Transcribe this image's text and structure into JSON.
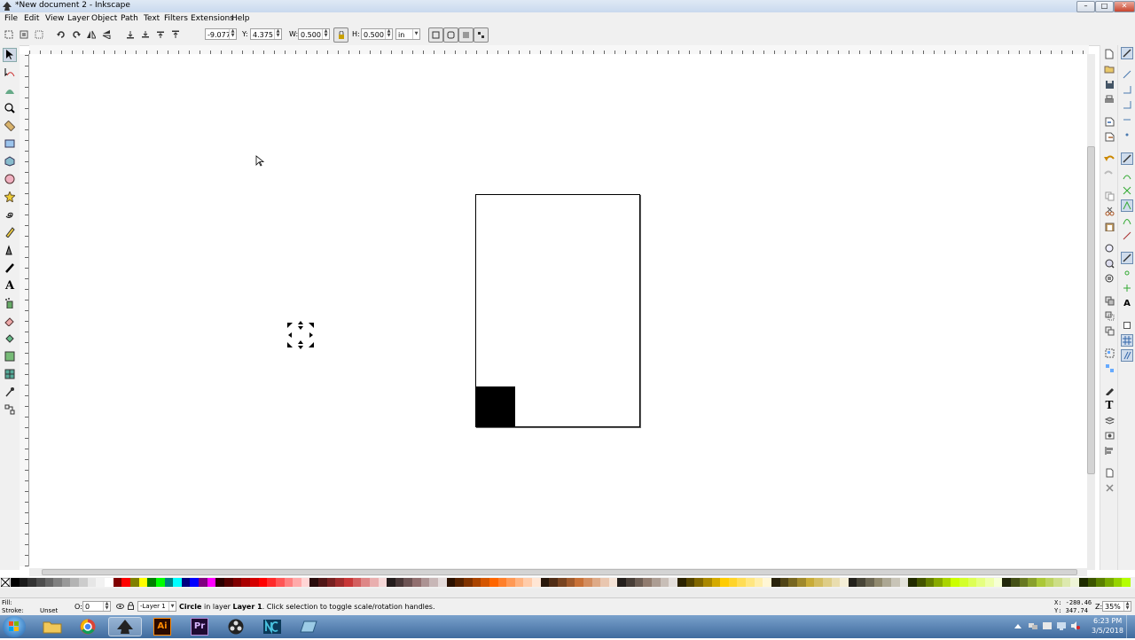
{
  "window": {
    "title": "*New document 2 - Inkscape"
  },
  "menu": [
    "File",
    "Edit",
    "View",
    "Layer",
    "Object",
    "Path",
    "Text",
    "Filters",
    "Extensions",
    "Help"
  ],
  "toolbar": {
    "x_label": "X:",
    "x_value": "-9.077",
    "y_label": "Y:",
    "y_value": "4.375",
    "w_label": "W:",
    "w_value": "0.500",
    "h_label": "H:",
    "h_value": "0.500",
    "unit": "in"
  },
  "status": {
    "fill_label": "Fill:",
    "stroke_label": "Stroke:",
    "stroke_value": "Unset",
    "opacity_label": "O:",
    "opacity_value": "0",
    "layer": "-Layer 1",
    "msg_bold": "Circle",
    "msg_mid": " in layer ",
    "msg_layer": "Layer 1",
    "msg_end": ". Click selection to toggle scale/rotation handles.",
    "cursor_x": "X: -280.46",
    "cursor_y": "Y:  347.74",
    "zoom_label": "Z:",
    "zoom_value": "35%"
  },
  "taskbar": {
    "time": "6:23 PM",
    "date": "3/5/2018"
  },
  "palette_colors": [
    "#000000",
    "#1a1a1a",
    "#333333",
    "#4d4d4d",
    "#666666",
    "#808080",
    "#999999",
    "#b3b3b3",
    "#cccccc",
    "#e6e6e6",
    "#f2f2f2",
    "#ffffff",
    "#800000",
    "#ff0000",
    "#808000",
    "#ffff00",
    "#008000",
    "#00ff00",
    "#008080",
    "#00ffff",
    "#000080",
    "#0000ff",
    "#800080",
    "#ff00ff",
    "#2b0000",
    "#550000",
    "#800000",
    "#aa0000",
    "#d40000",
    "#ff0000",
    "#ff2a2a",
    "#ff5555",
    "#ff8080",
    "#ffaaaa",
    "#ffd5d5",
    "#280b0b",
    "#501616",
    "#782121",
    "#a02c2c",
    "#c83737",
    "#d35f5f",
    "#de8787",
    "#e9afaf",
    "#f4d7d7",
    "#241c1c",
    "#483737",
    "#6c5353",
    "#916f6f",
    "#ac9393",
    "#c8b7b7",
    "#e3dbdb",
    "#2b1100",
    "#552200",
    "#803300",
    "#aa4400",
    "#d45500",
    "#ff6600",
    "#ff7f2a",
    "#ff9955",
    "#ffb380",
    "#ffccaa",
    "#ffe6d5",
    "#28170b",
    "#502d16",
    "#784421",
    "#a05a2c",
    "#c87137",
    "#d38d5f",
    "#deaa87",
    "#e9c6af",
    "#f4e3d7",
    "#241f1c",
    "#483e37",
    "#6c5d53",
    "#917c6f",
    "#ac9d93",
    "#c8beb7",
    "#e3dedb",
    "#2b2200",
    "#554400",
    "#806600",
    "#aa8800",
    "#d4aa00",
    "#ffcc00",
    "#ffd42a",
    "#ffdd55",
    "#ffe680",
    "#ffeeaa",
    "#fff6d5",
    "#28220b",
    "#504416",
    "#786721",
    "#a0892c",
    "#c8ab37",
    "#d3bc5f",
    "#decd87",
    "#e9ddaf",
    "#f4eed7",
    "#24221c",
    "#484537",
    "#6c6753",
    "#918a6f",
    "#aca793",
    "#c8c4b7",
    "#e3e2db",
    "#222b00",
    "#445500",
    "#668000",
    "#88aa00",
    "#aad400",
    "#ccff00",
    "#d4ff2a",
    "#ddff55",
    "#e5ff80",
    "#eeffaa",
    "#f6ffd5",
    "#22280b",
    "#445016",
    "#677821",
    "#89a02c",
    "#abc837",
    "#bcd35f",
    "#cdde87",
    "#dde9af",
    "#eef4d7",
    "#1e2b00",
    "#3c5500",
    "#5a8000",
    "#78aa00",
    "#96d400",
    "#b4ff00"
  ]
}
